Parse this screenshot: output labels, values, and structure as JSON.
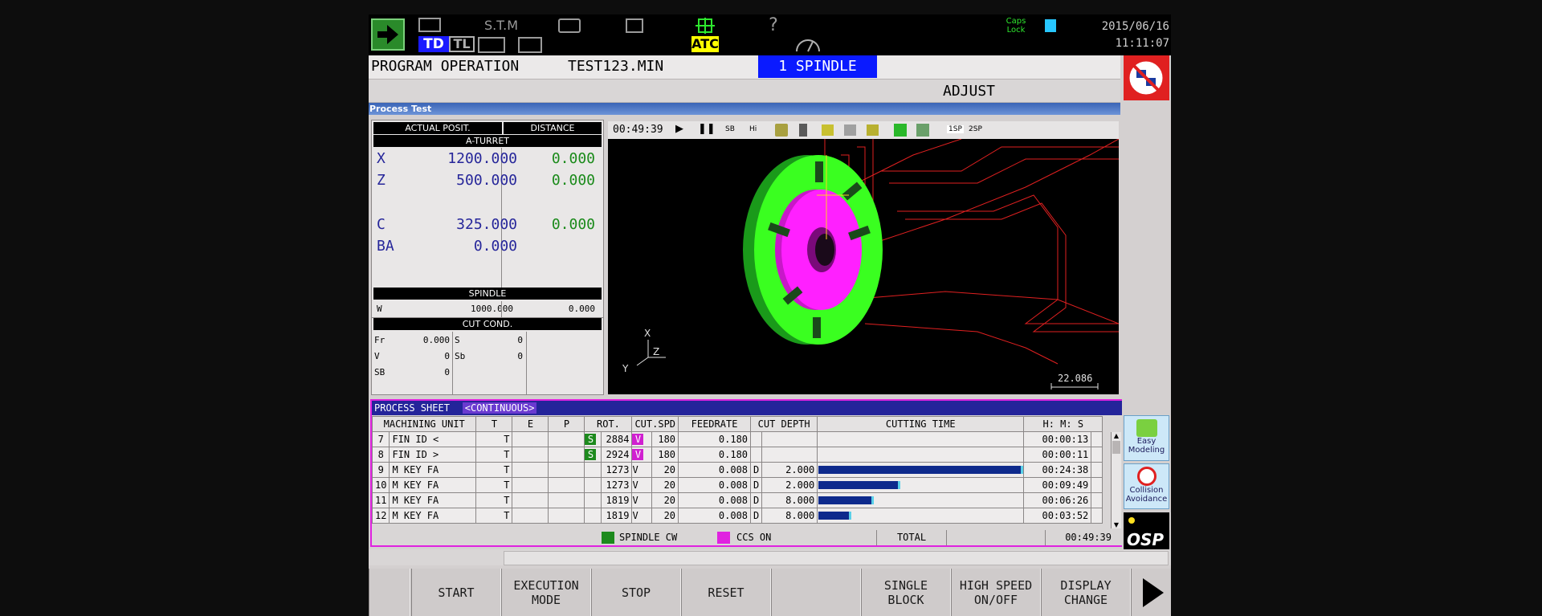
{
  "topbar": {
    "stm_label": "S.T.M",
    "td_label": "TD",
    "tl_label": "TL",
    "atc_label": "ATC",
    "help_label": "?",
    "caps_lock": "Caps\nLock",
    "date": "2015/06/16",
    "time": "11:11:07"
  },
  "header": {
    "mode": "PROGRAM OPERATION",
    "program": "TEST123.MIN",
    "spindle_tab": "1 SPINDLE",
    "sub_mode": "ADJUST"
  },
  "process_test_title": "Process Test",
  "position": {
    "col_actual": "ACTUAL POSIT.",
    "col_distance": "DISTANCE",
    "turret": "A-TURRET",
    "axes": [
      {
        "axis": "X",
        "actual": "1200.000",
        "distance": "0.000"
      },
      {
        "axis": "Z",
        "actual": "500.000",
        "distance": "0.000"
      },
      {
        "axis": "C",
        "actual": "325.000",
        "distance": "0.000"
      },
      {
        "axis": "BA",
        "actual": "0.000",
        "distance": ""
      }
    ],
    "spindle_head": "SPINDLE",
    "spindle_axis": "W",
    "spindle_actual": "1000.000",
    "spindle_distance": "0.000",
    "cut_cond_head": "CUT COND.",
    "cut_cond": [
      {
        "l1": "Fr",
        "v1": "0.000",
        "l2": "S",
        "v2": "0"
      },
      {
        "l1": "V",
        "v1": "0",
        "l2": "Sb",
        "v2": "0"
      },
      {
        "l1": "SB",
        "v1": "0",
        "l2": "",
        "v2": ""
      }
    ]
  },
  "viewer": {
    "elapsed": "00:49:39",
    "sb_label": "SB",
    "hi_label": "Hi",
    "sp1_label": "1SP",
    "sp2_label": "2SP",
    "axis_x": "X",
    "axis_y": "Y",
    "axis_z": "Z",
    "scale": "22.086"
  },
  "process_sheet": {
    "title": "PROCESS SHEET",
    "mode": "<CONTINUOUS>",
    "headers": [
      "MACHINING UNIT",
      "T",
      "E",
      "P",
      "ROT.",
      "CUT.SPD",
      "FEEDRATE",
      "CUT DEPTH",
      "CUTTING TIME",
      "H: M: S"
    ],
    "rows": [
      {
        "no": "7",
        "unit": "FIN ID <",
        "t": "T",
        "rot_flag": "S",
        "rot": "2884",
        "spd_flag": "V",
        "spd": "180",
        "feed": "0.180",
        "depth_flag": "",
        "depth": "",
        "bar": 0,
        "time": "00:00:13"
      },
      {
        "no": "8",
        "unit": "FIN ID >",
        "t": "T",
        "rot_flag": "S",
        "rot": "2924",
        "spd_flag": "V",
        "spd": "180",
        "feed": "0.180",
        "depth_flag": "",
        "depth": "",
        "bar": 0,
        "time": "00:00:11"
      },
      {
        "no": "9",
        "unit": "M KEY FA",
        "t": "T",
        "rot_flag": "",
        "rot": "1273",
        "spd_flag": "V",
        "spd": "20",
        "feed": "0.008",
        "depth_flag": "D",
        "depth": "2.000",
        "bar": 0.99,
        "time": "00:24:38"
      },
      {
        "no": "10",
        "unit": "M KEY FA",
        "t": "T",
        "rot_flag": "",
        "rot": "1273",
        "spd_flag": "V",
        "spd": "20",
        "feed": "0.008",
        "depth_flag": "D",
        "depth": "2.000",
        "bar": 0.39,
        "time": "00:09:49"
      },
      {
        "no": "11",
        "unit": "M KEY FA",
        "t": "T",
        "rot_flag": "",
        "rot": "1819",
        "spd_flag": "V",
        "spd": "20",
        "feed": "0.008",
        "depth_flag": "D",
        "depth": "8.000",
        "bar": 0.26,
        "time": "00:06:26"
      },
      {
        "no": "12",
        "unit": "M KEY FA",
        "t": "T",
        "rot_flag": "",
        "rot": "1819",
        "spd_flag": "V",
        "spd": "20",
        "feed": "0.008",
        "depth_flag": "D",
        "depth": "8.000",
        "bar": 0.15,
        "time": "00:03:52"
      }
    ],
    "legend_spindle": "SPINDLE CW",
    "legend_ccs": "CCS ON",
    "total_label": "TOTAL",
    "total_time": "00:49:39"
  },
  "side": {
    "easy_modeling": "Easy\nModeling",
    "collision": "Collision\nAvoidance",
    "osp": "OSP"
  },
  "fkeys": [
    {
      "l1": "",
      "l2": ""
    },
    {
      "l1": "START",
      "l2": ""
    },
    {
      "l1": "EXECUTION",
      "l2": "MODE"
    },
    {
      "l1": "STOP",
      "l2": ""
    },
    {
      "l1": "RESET",
      "l2": ""
    },
    {
      "l1": "",
      "l2": ""
    },
    {
      "l1": "SINGLE",
      "l2": "BLOCK"
    },
    {
      "l1": "HIGH SPEED",
      "l2": "ON/OFF"
    },
    {
      "l1": "DISPLAY",
      "l2": "CHANGE"
    }
  ],
  "colors": {
    "accent_blue": "#0a1aff",
    "highlight_magenta": "#e022e0",
    "spindle_green": "#1d8a1d",
    "atc_yellow": "#ffff00"
  }
}
